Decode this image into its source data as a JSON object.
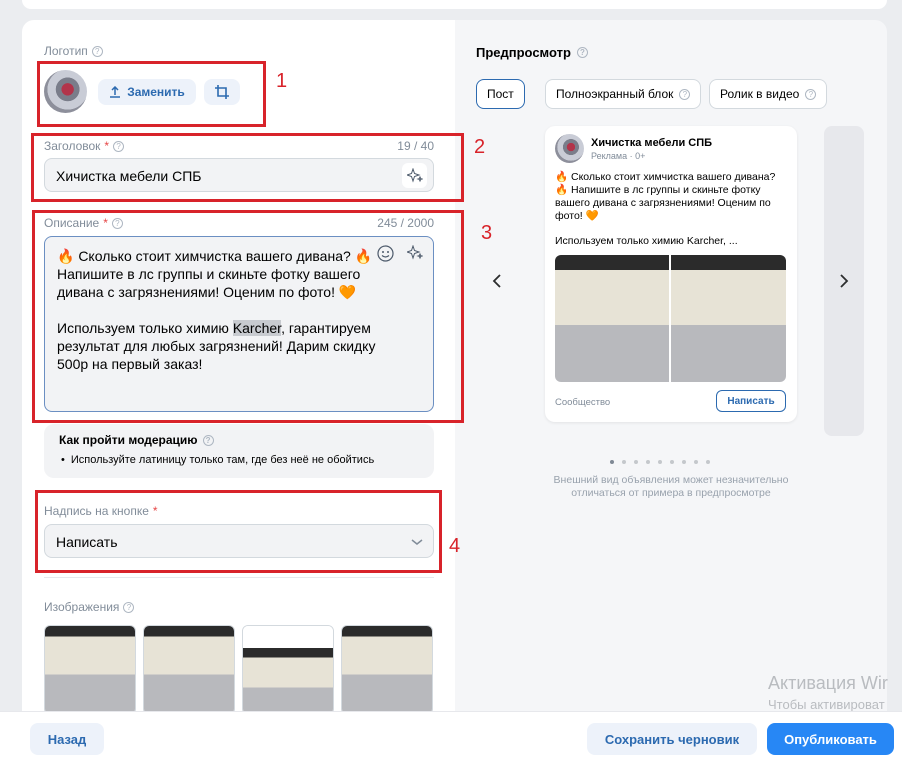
{
  "logo": {
    "label": "Логотип",
    "replace_label": "Заменить"
  },
  "headline": {
    "label": "Заголовок",
    "counter": "19 / 40",
    "value": "Хичистка мебели СПБ"
  },
  "description": {
    "label": "Описание",
    "counter": "245 / 2000",
    "value_before": "🔥 Сколько стоит химчистка вашего дивана? 🔥\nНапишите в лс группы и скиньте фотку вашего\nдивана с загрязнениями! Оценим по фото! 🧡\n\nИспользуем только химию ",
    "value_highlight": "Karcher",
    "value_after": ", гарантируем\nрезультат для любых загрязнений! Дарим скидку\n500р на первый заказ!"
  },
  "moderation": {
    "title": "Как пройти модерацию",
    "tip": "Используйте латиницу только там, где без неё не обойтись"
  },
  "button_caption": {
    "label": "Надпись на кнопке",
    "value": "Написать"
  },
  "images": {
    "label": "Изображения"
  },
  "annotations": [
    "1",
    "2",
    "3",
    "4"
  ],
  "preview": {
    "title": "Предпросмотр",
    "tabs": [
      "Пост",
      "Полноэкранный блок",
      "Ролик в видео"
    ],
    "active_tab": "Пост",
    "post": {
      "name": "Хичистка мебели СПБ",
      "meta": "Реклама · 0+",
      "text": "🔥 Сколько стоит химчистка вашего дивана?\n🔥 Напишите в лс группы и скиньте фотку вашего дивана с загрязнениями! Оценим по фото! 🧡",
      "text2": "Используем только химию Karcher, ...",
      "footer": "Сообщество",
      "cta": "Написать"
    },
    "page_count": 9,
    "active_page": 1,
    "note": "Внешний вид объявления может незначительно отличаться от примера в предпросмотре"
  },
  "footer": {
    "back": "Назад",
    "save_draft": "Сохранить черновик",
    "publish": "Опубликовать"
  },
  "watermark": {
    "line1": "Активация Wir",
    "line2": "Чтобы активироват"
  },
  "colors": {
    "accent": "#2c6ab0",
    "primary_button": "#2787f5",
    "annotation": "#d8232a"
  }
}
